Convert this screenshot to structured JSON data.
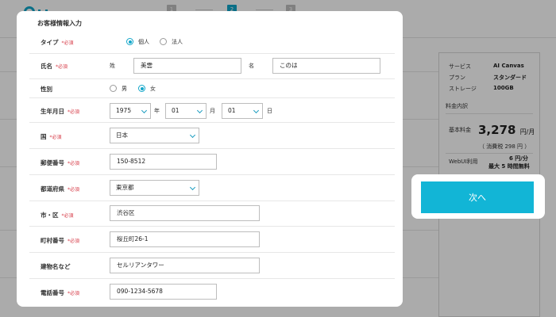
{
  "background": {
    "steps": [
      "1",
      "2",
      "3"
    ],
    "summary": {
      "rows": [
        {
          "label": "サービス",
          "value": "AI Canvas"
        },
        {
          "label": "プラン",
          "value": "スタンダード"
        },
        {
          "label": "ストレージ",
          "value": "100GB"
        }
      ],
      "section": "料金内訳",
      "base_label": "基本料金",
      "base_price": "3,278",
      "base_unit": "円/月",
      "tax_note": "（ 消費税 298 円 ）",
      "webui_label": "WebUI利用",
      "webui_price": "6 円/分",
      "webui_note": "最大 5 時間無料"
    },
    "next_label": "次へ"
  },
  "modal": {
    "title": "お客様情報入力",
    "required": "*必須",
    "type": {
      "label": "タイプ",
      "options": [
        "個人",
        "法人"
      ],
      "selected": 0
    },
    "name": {
      "label": "氏名",
      "last_label": "姓",
      "last_value": "美雲",
      "first_label": "名",
      "first_value": "このは"
    },
    "gender": {
      "label": "性別",
      "options": [
        "男",
        "女"
      ],
      "selected": 1
    },
    "birth": {
      "label": "生年月日",
      "year": "1975",
      "year_unit": "年",
      "month": "01",
      "month_unit": "月",
      "day": "01",
      "day_unit": "日"
    },
    "country": {
      "label": "国",
      "value": "日本"
    },
    "postal": {
      "label": "郵便番号",
      "value": "150-8512"
    },
    "prefecture": {
      "label": "都道府県",
      "value": "東京都"
    },
    "city": {
      "label": "市・区",
      "value": "渋谷区"
    },
    "town": {
      "label": "町村番号",
      "value": "桜丘町26-1"
    },
    "building": {
      "label": "建物名など",
      "value": "セルリアンタワー"
    },
    "phone": {
      "label": "電話番号",
      "value": "090-1234-5678"
    }
  }
}
